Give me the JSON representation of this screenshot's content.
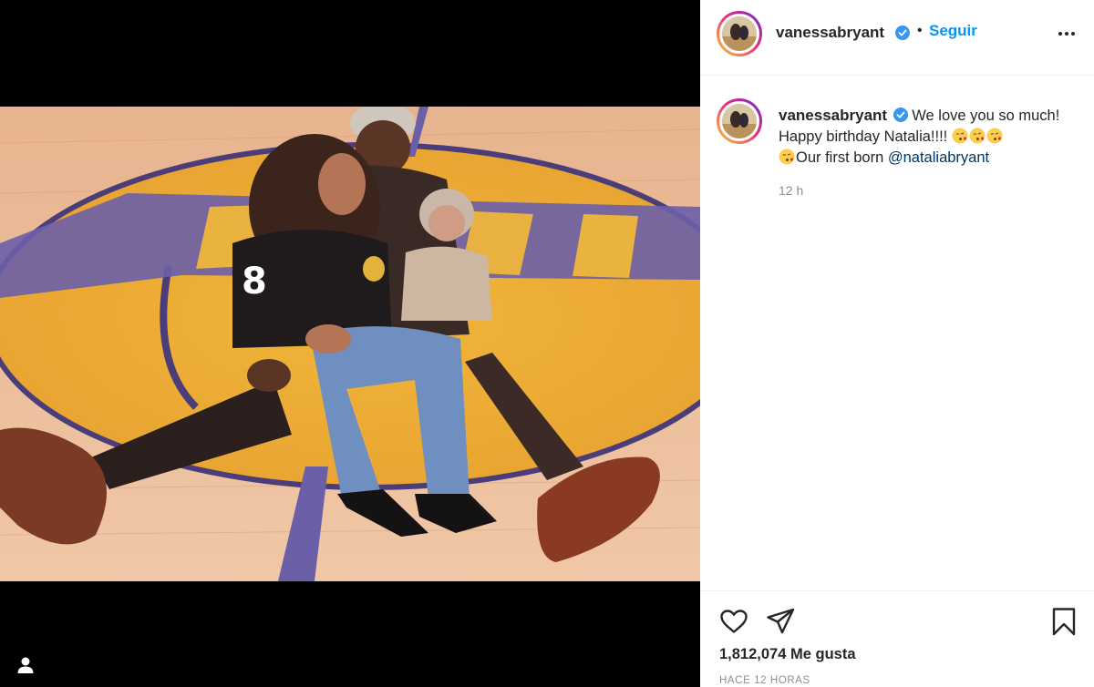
{
  "post": {
    "username": "vanessabryant",
    "follow_label": "Seguir",
    "separator": "•",
    "caption_text_1": "We love you so much! Happy birthday Natalia!!!! ",
    "caption_text_2": "Our first born ",
    "mention": "@nataliabryant",
    "time_ago": "12 h",
    "likes": "1,812,074 Me gusta",
    "date": "HACE 12 HORAS"
  },
  "icons": {
    "verified": "verified-badge-icon",
    "more": "more-options-icon",
    "like": "heart-icon",
    "share": "paper-plane-icon",
    "save": "bookmark-icon",
    "tag": "user-tag-icon",
    "emoji": "kissing-face-emoji"
  },
  "colors": {
    "accent": "#0095f6",
    "verified": "#3897f0",
    "mention": "#00376b",
    "muted": "#8e8e8e"
  }
}
